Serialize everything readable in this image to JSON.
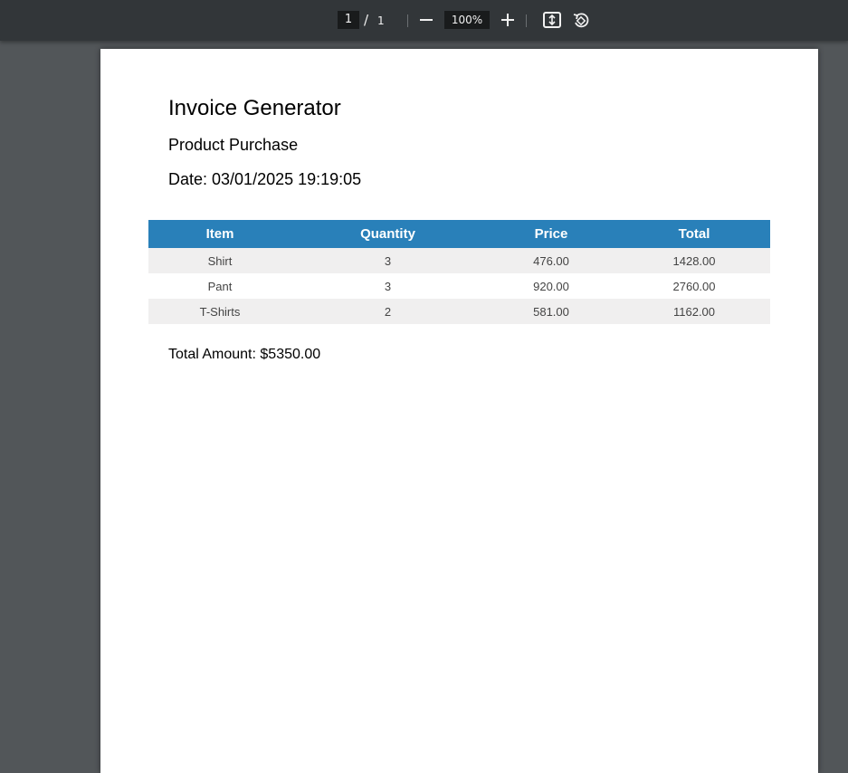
{
  "toolbar": {
    "current_page": "1",
    "page_separator": "/",
    "total_pages": "1",
    "zoom": "100%",
    "icons": [
      "zoom-out-icon",
      "zoom-in-icon",
      "fit-to-page-icon",
      "rotate-icon"
    ]
  },
  "document": {
    "title": "Invoice Generator",
    "subtitle": "Product Purchase",
    "date": "Date: 03/01/2025 19:19:05",
    "table": {
      "columns": [
        "Item",
        "Quantity",
        "Price",
        "Total"
      ],
      "rows": [
        [
          "Shirt",
          "3",
          "476.00",
          "1428.00"
        ],
        [
          "Pant",
          "3",
          "920.00",
          "2760.00"
        ],
        [
          "T-Shirts",
          "2",
          "581.00",
          "1162.00"
        ]
      ]
    },
    "total_amount": "Total Amount: $5350.00"
  },
  "colors": {
    "toolbar_bg": "#323639",
    "viewer_bg": "#525659",
    "table_header_bg": "#2980b9",
    "table_alt_row_bg": "#f0efef"
  }
}
